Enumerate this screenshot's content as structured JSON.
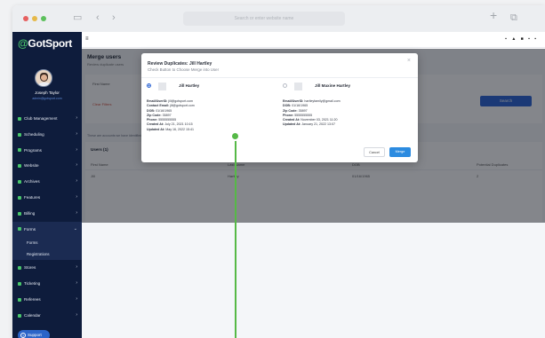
{
  "browser": {
    "url": "Search or enter website name",
    "controls": {
      "back": "‹",
      "forward": "›",
      "sidebar": "▭",
      "new_tab": "+",
      "tabs": "⧉"
    }
  },
  "sidebar": {
    "logo_prefix": "@",
    "logo_text": "GotSport",
    "user_name": "Joseph Taylor",
    "user_email": "admin@gotsport.com",
    "items": [
      {
        "label": "Club Management"
      },
      {
        "label": "Scheduling"
      },
      {
        "label": "Programs"
      },
      {
        "label": "Website"
      },
      {
        "label": "Archives"
      },
      {
        "label": "Features"
      },
      {
        "label": "Billing"
      },
      {
        "label": "Forms"
      },
      {
        "label": "Stores"
      },
      {
        "label": "Ticketing"
      },
      {
        "label": "Referees"
      },
      {
        "label": "Calendar"
      }
    ],
    "subitems": [
      "Forms",
      "Registrations"
    ],
    "support_label": "Support"
  },
  "topbar": {
    "menu": "≡",
    "icons": "▪ ▲ ■ ▪ ▪"
  },
  "page": {
    "title": "Merge users",
    "subtitle": "Review duplicate users",
    "filter_label": "First Name",
    "clear_filters": "Clear Filters",
    "search_button": "Search",
    "note": "These are accounts we have identified as possible duplicates",
    "users_title": "Users (1)",
    "columns": [
      "First Name",
      "Last Name",
      "DOB",
      "Potential Duplicates"
    ],
    "row": [
      "Jill",
      "Hartley",
      "01/16/1965",
      "2"
    ]
  },
  "modal": {
    "title": "Review Duplicates: Jill Hartley",
    "subtitle": "Check Button to Choose Merge into User",
    "close": "×",
    "left": {
      "name": "Jill Hartley",
      "lines": [
        {
          "k": "Email/UserID:",
          "v": "jill@gotsport.com"
        },
        {
          "k": "Contact Email:",
          "v": "jill@gotsport.com"
        },
        {
          "k": "DOB:",
          "v": "01/16/1965"
        },
        {
          "k": "Zip Code:",
          "v": "35897"
        },
        {
          "k": "Phone:",
          "v": "5555555555"
        },
        {
          "k": "Created At:",
          "v": "July 21, 2021 10:15"
        },
        {
          "k": "Updated At:",
          "v": "May 16, 2022 15:41"
        }
      ]
    },
    "right": {
      "name": "Jill Maxine Hartley",
      "lines": [
        {
          "k": "Email/UserID:",
          "v": "hartleyfamily@gmail.com"
        },
        {
          "k": "DOB:",
          "v": "01/16/1965"
        },
        {
          "k": "Zip Code:",
          "v": "35897"
        },
        {
          "k": "Phone:",
          "v": "5555555555"
        },
        {
          "k": "Created At:",
          "v": "November 03, 2021 11:20"
        },
        {
          "k": "Updated At:",
          "v": "January 21, 2022 13:07"
        }
      ]
    },
    "cancel_label": "Cancel",
    "merge_label": "Merge"
  },
  "colors": {
    "sidebar": "#0e1c3c",
    "accent_green": "#56b947",
    "primary_blue": "#2c65d4"
  }
}
